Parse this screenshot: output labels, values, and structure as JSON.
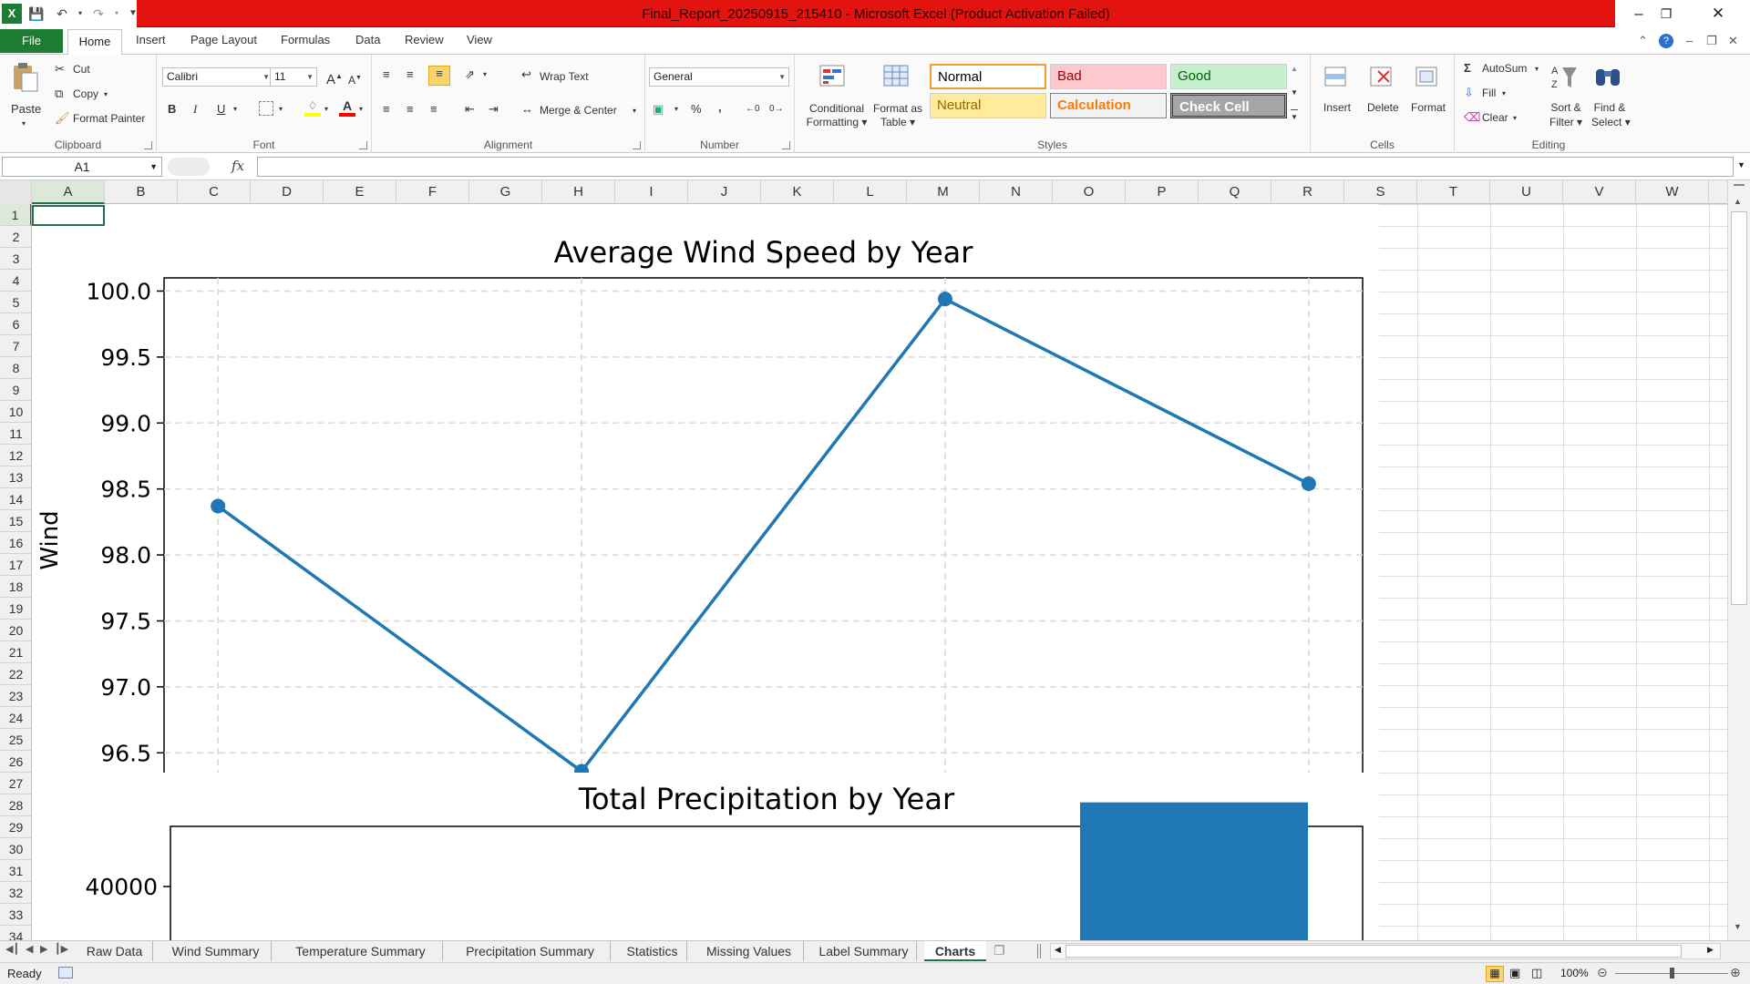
{
  "window": {
    "title": "Final_Report_20250915_215410 - Microsoft Excel (Product Activation Failed)",
    "accent": "#1e7c33",
    "alert_color": "#e3130f"
  },
  "ribbon_tabs": {
    "file": "File",
    "home": "Home",
    "insert": "Insert",
    "page_layout": "Page Layout",
    "formulas": "Formulas",
    "data": "Data",
    "review": "Review",
    "view": "View"
  },
  "clipboard": {
    "paste": "Paste",
    "cut": "Cut",
    "copy": "Copy",
    "format_painter": "Format Painter",
    "label": "Clipboard"
  },
  "font": {
    "name": "Calibri",
    "size": "11",
    "bold": "B",
    "italic": "I",
    "underline": "U",
    "label": "Font"
  },
  "alignment": {
    "wrap_text": "Wrap Text",
    "merge_center": "Merge & Center",
    "label": "Alignment"
  },
  "number": {
    "format": "General",
    "percent": "%",
    "comma": ",",
    "label": "Number"
  },
  "styles": {
    "conditional_formatting": [
      "Conditional",
      "Formatting"
    ],
    "format_as_table": [
      "Format as",
      "Table"
    ],
    "cells": [
      {
        "label": "Normal",
        "bg": "#ffffff",
        "fg": "#000000"
      },
      {
        "label": "Bad",
        "bg": "#ffc7ce",
        "fg": "#9c0006"
      },
      {
        "label": "Good",
        "bg": "#c6efce",
        "fg": "#006100"
      },
      {
        "label": "Neutral",
        "bg": "#ffeb9c",
        "fg": "#9c6500"
      },
      {
        "label": "Calculation",
        "bg": "#f2f2f2",
        "fg": "#fa7d00"
      },
      {
        "label": "Check Cell",
        "bg": "#a5a5a5",
        "fg": "#ffffff"
      }
    ],
    "label": "Styles"
  },
  "cells_group": {
    "insert": "Insert",
    "delete": "Delete",
    "format": "Format",
    "label": "Cells"
  },
  "editing": {
    "autosum": "AutoSum",
    "fill": "Fill",
    "clear": "Clear",
    "sort_filter": [
      "Sort &",
      "Filter"
    ],
    "find_select": [
      "Find &",
      "Select"
    ],
    "label": "Editing"
  },
  "formula_bar": {
    "name_box": "A1",
    "fx": "fx",
    "value": ""
  },
  "columns": [
    "A",
    "B",
    "C",
    "D",
    "E",
    "F",
    "G",
    "H",
    "I",
    "J",
    "K",
    "L",
    "M",
    "N",
    "O",
    "P",
    "Q",
    "R",
    "S",
    "T",
    "U",
    "V",
    "W"
  ],
  "rows": [
    "1",
    "2",
    "3",
    "4",
    "5",
    "6",
    "7",
    "8",
    "9",
    "10",
    "11",
    "12",
    "13",
    "14",
    "15",
    "16",
    "17",
    "18",
    "19",
    "20",
    "21",
    "22",
    "23",
    "24",
    "25",
    "26",
    "27",
    "28",
    "29",
    "30",
    "31",
    "32",
    "33",
    "34"
  ],
  "chart_data": [
    {
      "type": "line",
      "title": "Average Wind Speed by Year",
      "xlabel": "",
      "ylabel": "Wind",
      "x": [
        1,
        2,
        3,
        4
      ],
      "values": [
        98.37,
        96.36,
        99.94,
        98.54
      ],
      "ylim": [
        96.35,
        100.1
      ],
      "yticks": [
        96.5,
        97.0,
        97.5,
        98.0,
        98.5,
        99.0,
        99.5,
        100.0
      ],
      "ytick_labels": [
        "96.5",
        "97.0",
        "97.5",
        "98.0",
        "98.5",
        "99.0",
        "99.5",
        "100.0"
      ],
      "grid": true,
      "color": "#1f77b4"
    },
    {
      "type": "bar",
      "title": "Total Precipitation by Year",
      "xlabel": "",
      "ylabel": "",
      "values": [
        43800
      ],
      "yticks": [
        40000
      ],
      "ytick_labels": [
        "40000"
      ],
      "ylim": [
        38500,
        45000
      ],
      "color": "#1f77b4"
    }
  ],
  "sheet_tabs": [
    "Raw Data",
    "Wind Summary",
    "Temperature Summary",
    "Precipitation Summary",
    "Statistics",
    "Missing Values",
    "Label Summary",
    "Charts"
  ],
  "active_sheet": "Charts",
  "status": {
    "ready": "Ready",
    "zoom": "100%"
  }
}
